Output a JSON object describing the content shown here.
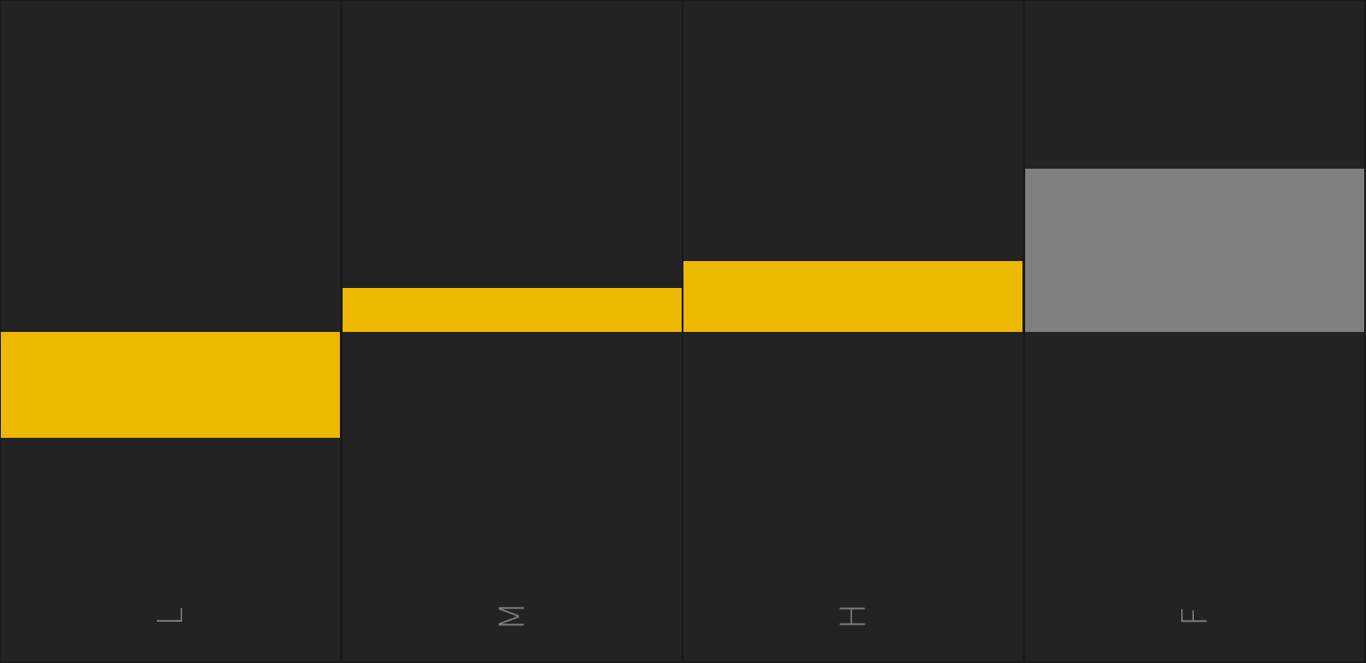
{
  "colors": {
    "background": "#1a1a1a",
    "band": "#232323",
    "active_bar": "#ecb800",
    "inactive_bar": "#808080",
    "label": "#7f7f7f"
  },
  "zero_line": 0,
  "range": [
    -4,
    5
  ],
  "bands": [
    {
      "label": "L",
      "value": -1.2,
      "active": true
    },
    {
      "label": "M",
      "value": 0.5,
      "active": true
    },
    {
      "label": "H",
      "value": 0.8,
      "active": true
    },
    {
      "label": "F",
      "value": 1.85,
      "active": false
    }
  ]
}
